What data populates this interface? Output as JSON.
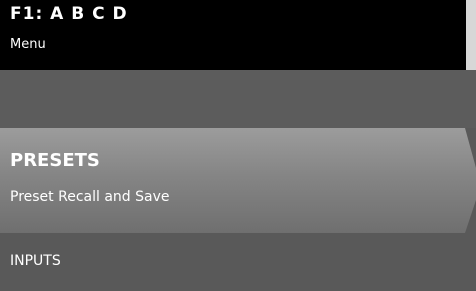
{
  "header": {
    "title": "F1: A B C D",
    "subtitle": "Menu"
  },
  "menu": {
    "items": [
      {
        "label": "PRESETS",
        "description": "Preset Recall and Save",
        "selected": true
      },
      {
        "label": "INPUTS",
        "selected": false
      }
    ]
  },
  "colors": {
    "header_bg": "#000000",
    "body_bg": "#595959",
    "selected_gradient_top": "#9c9c9c",
    "selected_gradient_bottom": "#6f6f6f",
    "text": "#ffffff"
  }
}
